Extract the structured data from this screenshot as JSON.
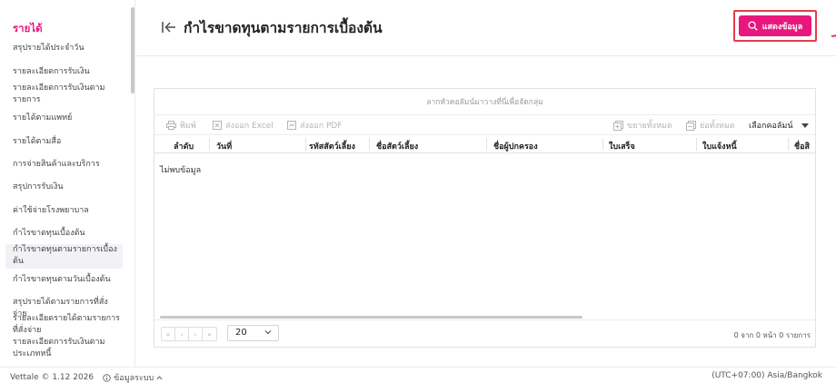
{
  "sidebar": {
    "section_title": "รายได้",
    "items": [
      {
        "label": "สรุปรายได้ประจำวัน",
        "active": false
      },
      {
        "label": "รายละเอียดการรับเงิน",
        "active": false
      },
      {
        "label": "รายละเอียดการรับเงินตามรายการ",
        "active": false
      },
      {
        "label": "รายได้ตามแพทย์",
        "active": false
      },
      {
        "label": "รายได้ตามสื่อ",
        "active": false
      },
      {
        "label": "การจ่ายสินค้าและบริการ",
        "active": false
      },
      {
        "label": "สรุปการรับเงิน",
        "active": false
      },
      {
        "label": "ค่าใช้จ่ายโรงพยาบาล",
        "active": false
      },
      {
        "label": "กำไรขาดทุนเบื้องต้น",
        "active": false
      },
      {
        "label": "กำไรขาดทุนตามรายการเบื้องต้น",
        "active": true
      },
      {
        "label": "กำไรขาดทุนตามวันเบื้องต้น",
        "active": false
      },
      {
        "label": "สรุปรายได้ตามรายการที่สั่งจ่าย",
        "active": false
      },
      {
        "label": "รายละเอียดรายได้ตามรายการที่สั่งจ่าย",
        "active": false
      },
      {
        "label": "รายละเอียดการรับเงินตามประเภทหนี้",
        "active": false
      }
    ]
  },
  "header": {
    "title": "กำไรขาดทุนตามรายการเบื้องต้น",
    "show_button_label": "แสดงข้อมูล"
  },
  "grid": {
    "group_panel_text": "ลากหัวคอลัมน์มาวางที่นี่เพื่อจัดกลุ่ม",
    "toolbar": {
      "print": "พิมพ์",
      "export_excel": "ส่งออก Excel",
      "export_pdf": "ส่งออก PDF",
      "expand_all": "ขยายทั้งหมด",
      "collapse_all": "ย่อทั้งหมด",
      "choose_columns": "เลือกคอลัมน์"
    },
    "columns": [
      "ลำดับ",
      "วันที่",
      "รหัสสัตว์เลี้ยง",
      "ชื่อสัตว์เลี้ยง",
      "ชื่อผู้ปกครอง",
      "ใบเสร็จ",
      "ใบแจ้งหนี้",
      "ชื่อสิ"
    ],
    "no_data_text": "ไม่พบข้อมูล",
    "pager": {
      "first": "«",
      "prev": "‹",
      "next": "›",
      "last": "»",
      "page_size": "20",
      "range_text": "0 จาก 0 หน้า 0 รายการ"
    }
  },
  "statusbar": {
    "version": "Vettale © 1.12 2026",
    "system_info": "ข้อมูลระบบ",
    "timezone": "(UTC+07:00) Asia/Bangkok"
  },
  "colors": {
    "accent": "#e8177d",
    "highlight_border": "#e63b4d",
    "active_item_bg": "#f1f2f5"
  }
}
